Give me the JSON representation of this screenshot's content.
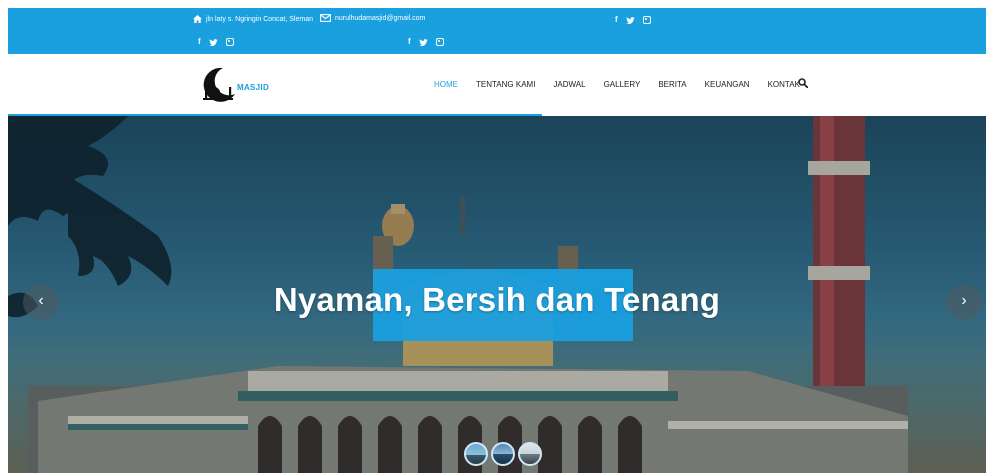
{
  "topbar": {
    "address": "jln laty s. Ngringin Concat, Sleman",
    "email": "nurulhudamasjid@gmail.com",
    "social": [
      "f",
      "twitter",
      "instagram"
    ]
  },
  "logo": {
    "text": "MASJID"
  },
  "nav": {
    "items": [
      {
        "label": "HOME",
        "active": true
      },
      {
        "label": "TENTANG KAMI",
        "active": false
      },
      {
        "label": "JADWAL",
        "active": false
      },
      {
        "label": "GALLERY",
        "active": false
      },
      {
        "label": "BERITA",
        "active": false
      },
      {
        "label": "KEUANGAN",
        "active": false
      },
      {
        "label": "KONTAK",
        "active": false
      }
    ]
  },
  "hero": {
    "title": "Nyaman, Bersih dan Tenang",
    "prev_label": "‹",
    "next_label": "›",
    "thumbnails": 3
  },
  "colors": {
    "accent": "#1a9fdf",
    "nav_text": "#222222"
  }
}
